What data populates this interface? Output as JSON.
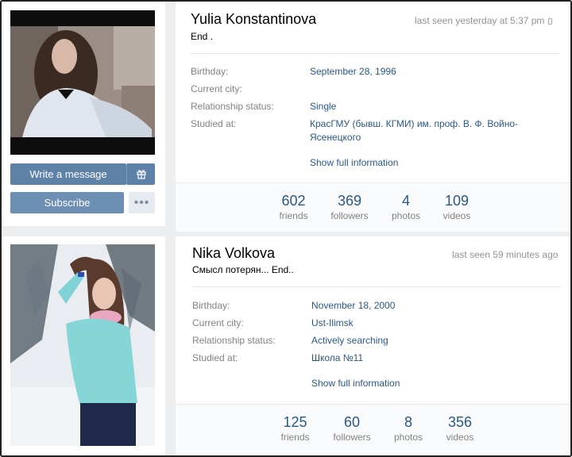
{
  "profiles": [
    {
      "name": "Yulia Konstantinova",
      "status": "End .",
      "last_seen": "last seen yesterday at 5:37 pm",
      "last_seen_device_icon": "phone-icon",
      "info": {
        "birthday_label": "Birthday:",
        "birthday": "September 28, 1996",
        "city_label": "Current city:",
        "city": "",
        "relationship_label": "Relationship status:",
        "relationship": "Single",
        "studied_label": "Studied at:",
        "studied_line1": "КрасГМУ (бывш. КГМИ) им. проф. В. Ф. Войно-",
        "studied_line2": "Ясенецкого"
      },
      "show_full": "Show full information",
      "buttons": {
        "message": "Write a message",
        "gift_icon": "gift-icon",
        "subscribe": "Subscribe",
        "more": "•••"
      },
      "counters": [
        {
          "num": "602",
          "label": "friends"
        },
        {
          "num": "369",
          "label": "followers"
        },
        {
          "num": "4",
          "label": "photos"
        },
        {
          "num": "109",
          "label": "videos"
        }
      ]
    },
    {
      "name": "Nika Volkova",
      "status": "Смысл потерян... End..",
      "last_seen": "last seen 59 minutes ago",
      "info": {
        "birthday_label": "Birthday:",
        "birthday": "November 18, 2000",
        "city_label": "Current city:",
        "city": "Ust-Ilimsk",
        "relationship_label": "Relationship status:",
        "relationship": "Actively searching",
        "studied_label": "Studied at:",
        "studied_line1": "Школа №11"
      },
      "show_full": "Show full information",
      "counters": [
        {
          "num": "125",
          "label": "friends"
        },
        {
          "num": "60",
          "label": "followers"
        },
        {
          "num": "8",
          "label": "photos"
        },
        {
          "num": "356",
          "label": "videos"
        }
      ]
    }
  ],
  "colors": {
    "page_bg": "#edeef0",
    "link": "#2a5885",
    "button": "#5e81a8",
    "muted": "#828282"
  }
}
